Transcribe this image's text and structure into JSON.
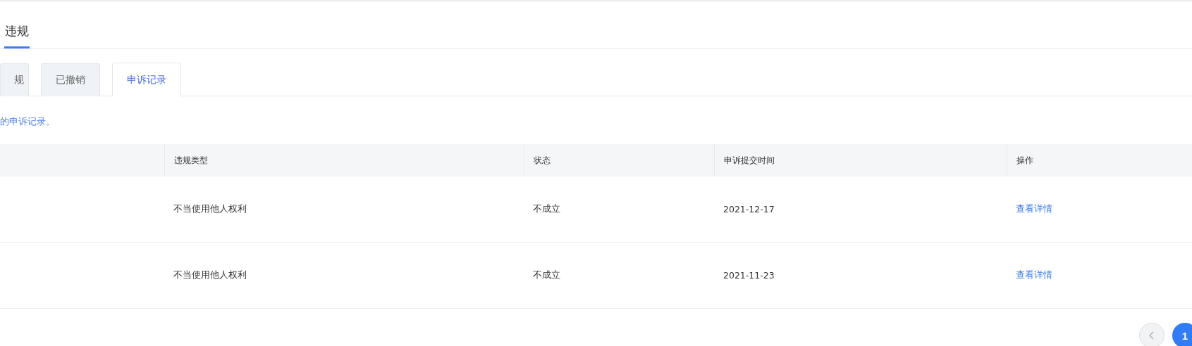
{
  "main_tab": {
    "label": "违规",
    "selected": true
  },
  "sub_tabs": [
    {
      "label": "规",
      "selected": false
    },
    {
      "label": "已撤销",
      "selected": false
    },
    {
      "label": "申诉记录",
      "selected": true
    }
  ],
  "note": "的申诉记录。",
  "table": {
    "columns": [
      "违规类型",
      "状态",
      "申诉提交时间",
      "操作"
    ],
    "rows": [
      {
        "cells": [
          "不当使用他人权利",
          "不成立",
          "2021-12-17"
        ],
        "action": "查看详情"
      },
      {
        "cells": [
          "不当使用他人权利",
          "不成立",
          "2021-11-23"
        ],
        "action": "查看详情"
      }
    ]
  },
  "pagination": {
    "pages": [
      {
        "label": "1",
        "selected": true
      }
    ]
  }
}
